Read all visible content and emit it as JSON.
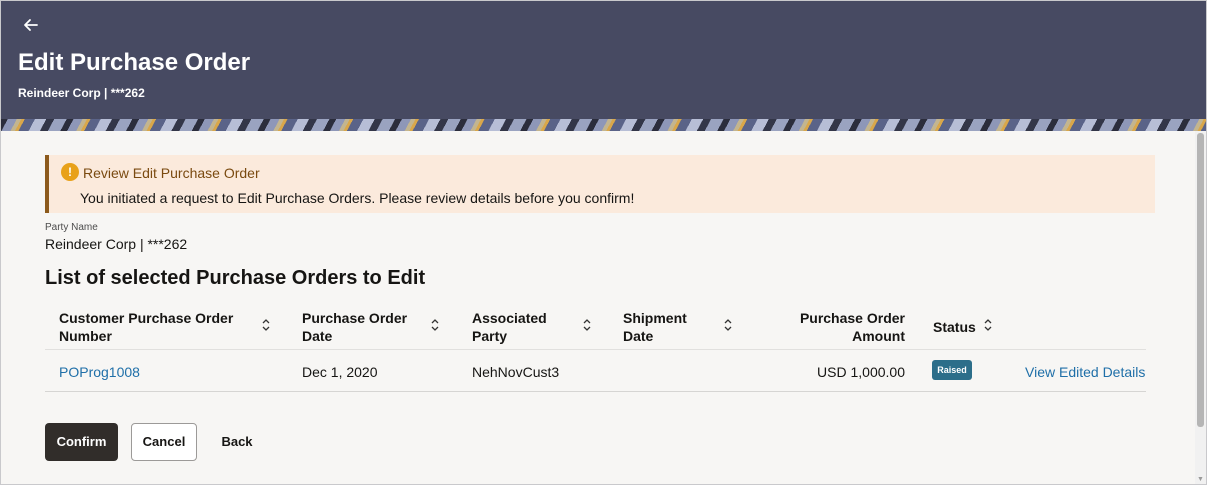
{
  "header": {
    "back_icon": "arrow-left-icon",
    "title": "Edit Purchase Order",
    "subtitle": "Reindeer Corp | ***262"
  },
  "alert": {
    "icon": "info-icon",
    "icon_glyph": "!",
    "title": "Review Edit Purchase Order",
    "message": "You initiated a request to Edit Purchase Orders. Please review details before you confirm!"
  },
  "party": {
    "label": "Party Name",
    "value": "Reindeer Corp | ***262"
  },
  "list": {
    "title": "List of selected Purchase Orders to Edit",
    "columns": {
      "po_number_line1": "Customer Purchase Order",
      "po_number_line2": "Number",
      "po_date_line1": "Purchase Order",
      "po_date_line2": "Date",
      "party_line1": "Associated",
      "party_line2": "Party",
      "shipment_line1": "Shipment",
      "shipment_line2": "Date",
      "amount_line1": "Purchase Order",
      "amount_line2": "Amount",
      "status": "Status"
    },
    "rows": [
      {
        "po_number": "POProg1008",
        "po_date": "Dec 1, 2020",
        "associated_party": "NehNovCust3",
        "shipment_date": "",
        "amount": "USD 1,000.00",
        "status": "Raised",
        "action": "View Edited Details"
      }
    ]
  },
  "actions": {
    "confirm": "Confirm",
    "cancel": "Cancel",
    "back": "Back"
  },
  "colors": {
    "header_bg": "#474a62",
    "alert_bg": "#fbeadc",
    "link": "#1f6fa8",
    "status_badge": "#2c6e8a",
    "primary_button": "#312d2a"
  }
}
